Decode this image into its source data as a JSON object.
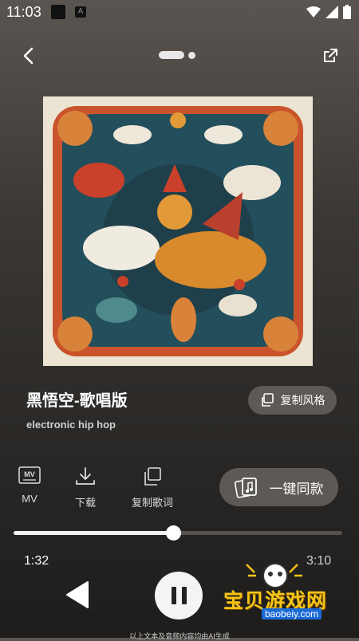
{
  "status_bar": {
    "time": "11:03",
    "notif_icon_letter": "A"
  },
  "header": {
    "back_icon": "chevron-left-icon",
    "share_icon": "share-out-icon"
  },
  "song": {
    "title": "黑悟空-歌唱版",
    "style": "electronic hip hop",
    "copy_style_label": "复制风格"
  },
  "actions": {
    "mv_icon_text": "MV",
    "mv_label": "MV",
    "download_label": "下载",
    "copy_lyrics_label": "复制歌词",
    "one_key_label": "一键同款"
  },
  "player": {
    "current_time": "1:32",
    "total_time": "3:10",
    "progress": 0.485
  },
  "watermark": {
    "text": "宝贝游戏网",
    "url": "baobeiy.com"
  },
  "footer": {
    "note": "以上文本及音频内容均由AI生成"
  },
  "colors": {
    "accent": "#f4f4f4",
    "chip_bg": "#5c5956",
    "watermark_yellow": "#f5c518"
  }
}
